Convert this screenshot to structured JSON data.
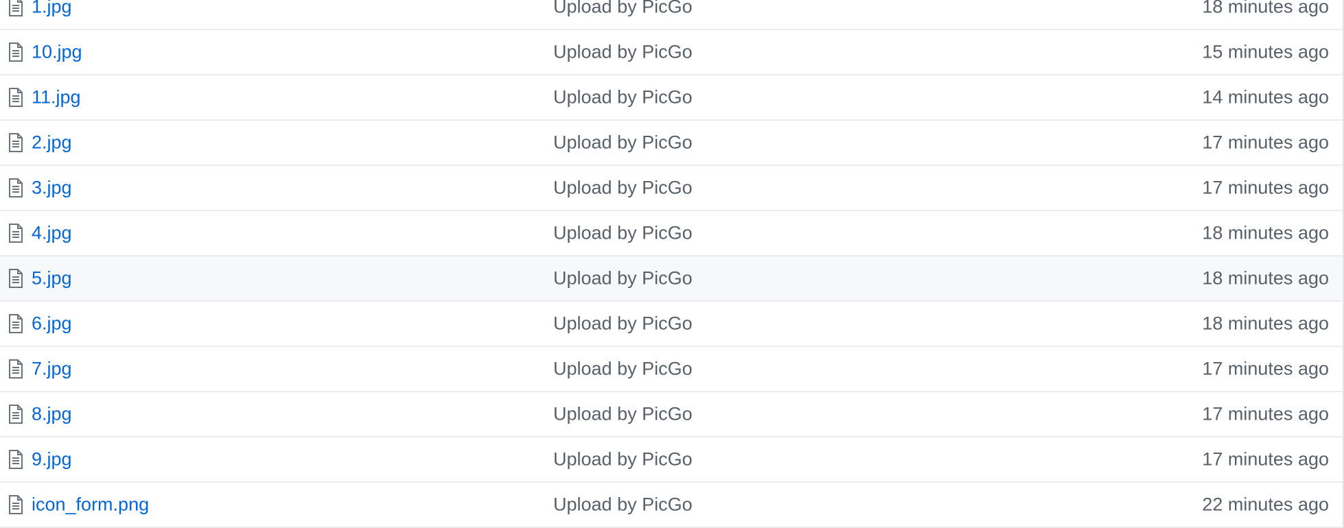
{
  "files": [
    {
      "name": "1.jpg",
      "message": "Upload by PicGo",
      "age": "18 minutes ago",
      "icon": "file-icon"
    },
    {
      "name": "10.jpg",
      "message": "Upload by PicGo",
      "age": "15 minutes ago",
      "icon": "file-icon"
    },
    {
      "name": "11.jpg",
      "message": "Upload by PicGo",
      "age": "14 minutes ago",
      "icon": "file-icon"
    },
    {
      "name": "2.jpg",
      "message": "Upload by PicGo",
      "age": "17 minutes ago",
      "icon": "file-icon"
    },
    {
      "name": "3.jpg",
      "message": "Upload by PicGo",
      "age": "17 minutes ago",
      "icon": "file-icon"
    },
    {
      "name": "4.jpg",
      "message": "Upload by PicGo",
      "age": "18 minutes ago",
      "icon": "file-icon"
    },
    {
      "name": "5.jpg",
      "message": "Upload by PicGo",
      "age": "18 minutes ago",
      "icon": "file-icon"
    },
    {
      "name": "6.jpg",
      "message": "Upload by PicGo",
      "age": "18 minutes ago",
      "icon": "file-icon"
    },
    {
      "name": "7.jpg",
      "message": "Upload by PicGo",
      "age": "17 minutes ago",
      "icon": "file-icon"
    },
    {
      "name": "8.jpg",
      "message": "Upload by PicGo",
      "age": "17 minutes ago",
      "icon": "file-icon"
    },
    {
      "name": "9.jpg",
      "message": "Upload by PicGo",
      "age": "17 minutes ago",
      "icon": "file-icon"
    },
    {
      "name": "icon_form.png",
      "message": "Upload by PicGo",
      "age": "22 minutes ago",
      "icon": "file-icon"
    }
  ],
  "colors": {
    "link": "#0366d6",
    "muted": "#586069",
    "border": "#eaecef",
    "hover_row": "#f6f8fa"
  }
}
